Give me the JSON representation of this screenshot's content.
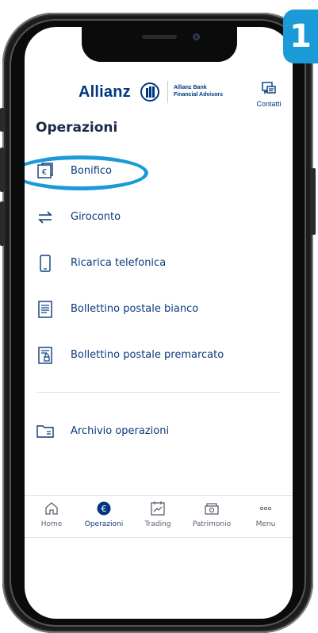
{
  "step_badge": "1",
  "header": {
    "brand": "Allianz",
    "sub_line1": "Allianz Bank",
    "sub_line2": "Financial Advisors",
    "contact_label": "Contatti"
  },
  "page_title": "Operazioni",
  "menu": [
    {
      "label": "Bonifico",
      "icon": "euro-card-icon"
    },
    {
      "label": "Giroconto",
      "icon": "transfer-arrows-icon"
    },
    {
      "label": "Ricarica telefonica",
      "icon": "phone-icon"
    },
    {
      "label": "Bollettino postale bianco",
      "icon": "document-icon"
    },
    {
      "label": "Bollettino postale premarcato",
      "icon": "document-lock-icon"
    },
    {
      "label": "Archivio operazioni",
      "icon": "folder-icon"
    }
  ],
  "tabs": [
    {
      "label": "Home",
      "icon": "home-icon",
      "active": false
    },
    {
      "label": "Operazioni",
      "icon": "operations-euro-icon",
      "active": true
    },
    {
      "label": "Trading",
      "icon": "chart-icon",
      "active": false
    },
    {
      "label": "Patrimonio",
      "icon": "wallet-icon",
      "active": false
    },
    {
      "label": "Menu",
      "icon": "more-icon",
      "active": false
    }
  ],
  "colors": {
    "accent": "#1a9bd7",
    "brand": "#003781",
    "text": "#0b3a7a"
  }
}
